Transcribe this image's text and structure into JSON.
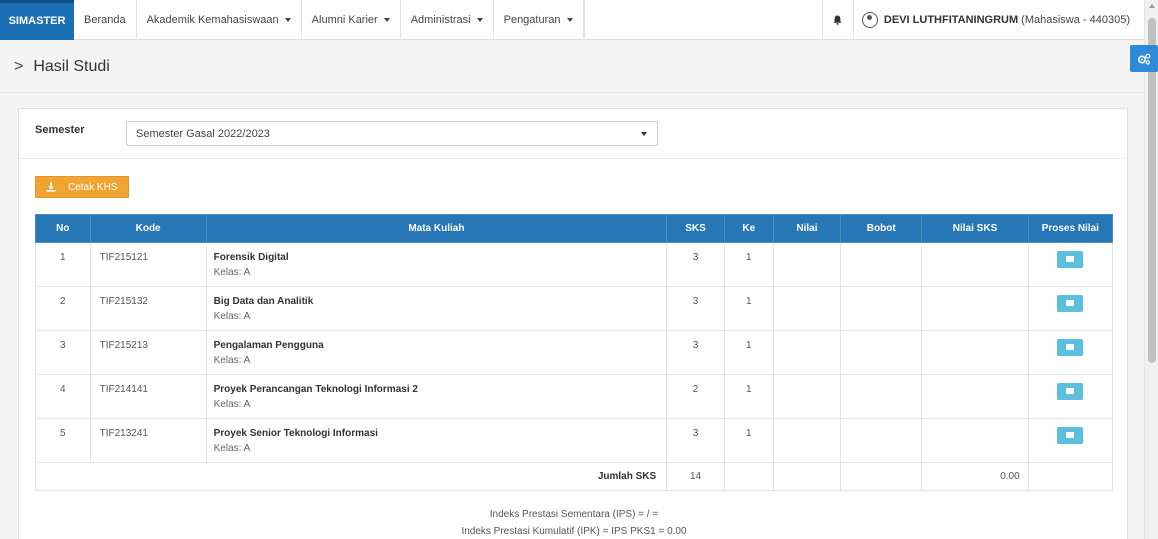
{
  "navbar": {
    "brand": "SIMASTER",
    "items": [
      {
        "label": "Beranda",
        "dropdown": false
      },
      {
        "label": "Akademik Kemahasiswaan",
        "dropdown": true
      },
      {
        "label": "Alumni Karier",
        "dropdown": true
      },
      {
        "label": "Administrasi",
        "dropdown": true
      },
      {
        "label": "Pengaturan",
        "dropdown": true
      }
    ],
    "user_name": "DEVI LUTHFITANINGRUM",
    "user_role": "(Mahasiswa - 440305)"
  },
  "page": {
    "title": "Hasil Studi"
  },
  "filter": {
    "label": "Semester",
    "selected": "Semester Gasal 2022/2023"
  },
  "actions": {
    "cetak_label": "Cetak KHS"
  },
  "table": {
    "headers": [
      "No",
      "Kode",
      "Mata Kuliah",
      "SKS",
      "Ke",
      "Nilai",
      "Bobot",
      "Nilai SKS",
      "Proses Nilai"
    ],
    "rows": [
      {
        "no": "1",
        "kode": "TIF215121",
        "nama": "Forensik Digital",
        "kelas": "Kelas: A",
        "sks": "3",
        "ke": "1",
        "nilai": "",
        "bobot": "",
        "nilai_sks": ""
      },
      {
        "no": "2",
        "kode": "TIF215132",
        "nama": "Big Data dan Analitik",
        "kelas": "Kelas: A",
        "sks": "3",
        "ke": "1",
        "nilai": "",
        "bobot": "",
        "nilai_sks": ""
      },
      {
        "no": "3",
        "kode": "TIF215213",
        "nama": "Pengalaman Pengguna",
        "kelas": "Kelas: A",
        "sks": "3",
        "ke": "1",
        "nilai": "",
        "bobot": "",
        "nilai_sks": ""
      },
      {
        "no": "4",
        "kode": "TIF214141",
        "nama": "Proyek Perancangan Teknologi Informasi 2",
        "kelas": "Kelas: A",
        "sks": "2",
        "ke": "1",
        "nilai": "",
        "bobot": "",
        "nilai_sks": ""
      },
      {
        "no": "5",
        "kode": "TIF213241",
        "nama": "Proyek Senior Teknologi Informasi",
        "kelas": "Kelas: A",
        "sks": "3",
        "ke": "1",
        "nilai": "",
        "bobot": "",
        "nilai_sks": ""
      }
    ],
    "total_label": "Jumlah SKS",
    "total_sks": "14",
    "total_nilai_sks": "0.00"
  },
  "summary": {
    "ips": "Indeks Prestasi Sementara (IPS) = / =",
    "ipk": "Indeks Prestasi Kumulatif (IPK) = IPS PKS1 = 0.00"
  },
  "colors": {
    "brand": "#1a6fb5",
    "table_header": "#2777b7",
    "cetak_button": "#f0a432",
    "proses_button": "#5bc0de"
  }
}
